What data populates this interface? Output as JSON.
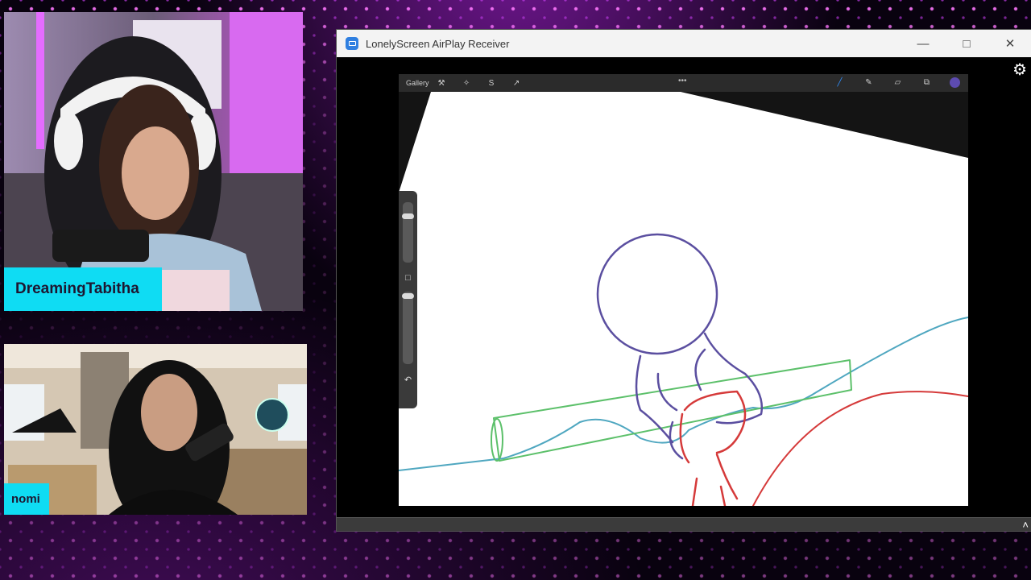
{
  "webcam_main": {
    "name": "DreamingTabitha"
  },
  "webcam_guest": {
    "name": "nomi"
  },
  "window": {
    "title": "LonelyScreen AirPlay Receiver",
    "controls": {
      "minimize": "—",
      "maximize": "□",
      "close": "✕"
    },
    "settings_icon": "⚙",
    "expand_icon": "˄"
  },
  "procreate": {
    "gallery_label": "Gallery",
    "tools_left": [
      {
        "icon": "wrench-icon",
        "glyph": "⚒"
      },
      {
        "icon": "magic-wand-icon",
        "glyph": "✧"
      },
      {
        "icon": "selection-icon",
        "glyph": "S"
      },
      {
        "icon": "transform-icon",
        "glyph": "↗"
      }
    ],
    "menu_dots": "•••",
    "tools_right": [
      {
        "icon": "brush-icon",
        "glyph": "╱"
      },
      {
        "icon": "smudge-icon",
        "glyph": "✎"
      },
      {
        "icon": "eraser-icon",
        "glyph": "▱"
      },
      {
        "icon": "layers-icon",
        "glyph": "⧉"
      }
    ],
    "color_swatch": "#5d4bb1",
    "sidebar": {
      "modify_glyph": "□",
      "undo_glyph": "↶"
    }
  },
  "colors": {
    "nametag": "#0fdcf3",
    "sketch_purple": "#5b4fa0",
    "sketch_green": "#5cc06a",
    "sketch_teal": "#4fa7c0",
    "sketch_red": "#d53a3a"
  }
}
